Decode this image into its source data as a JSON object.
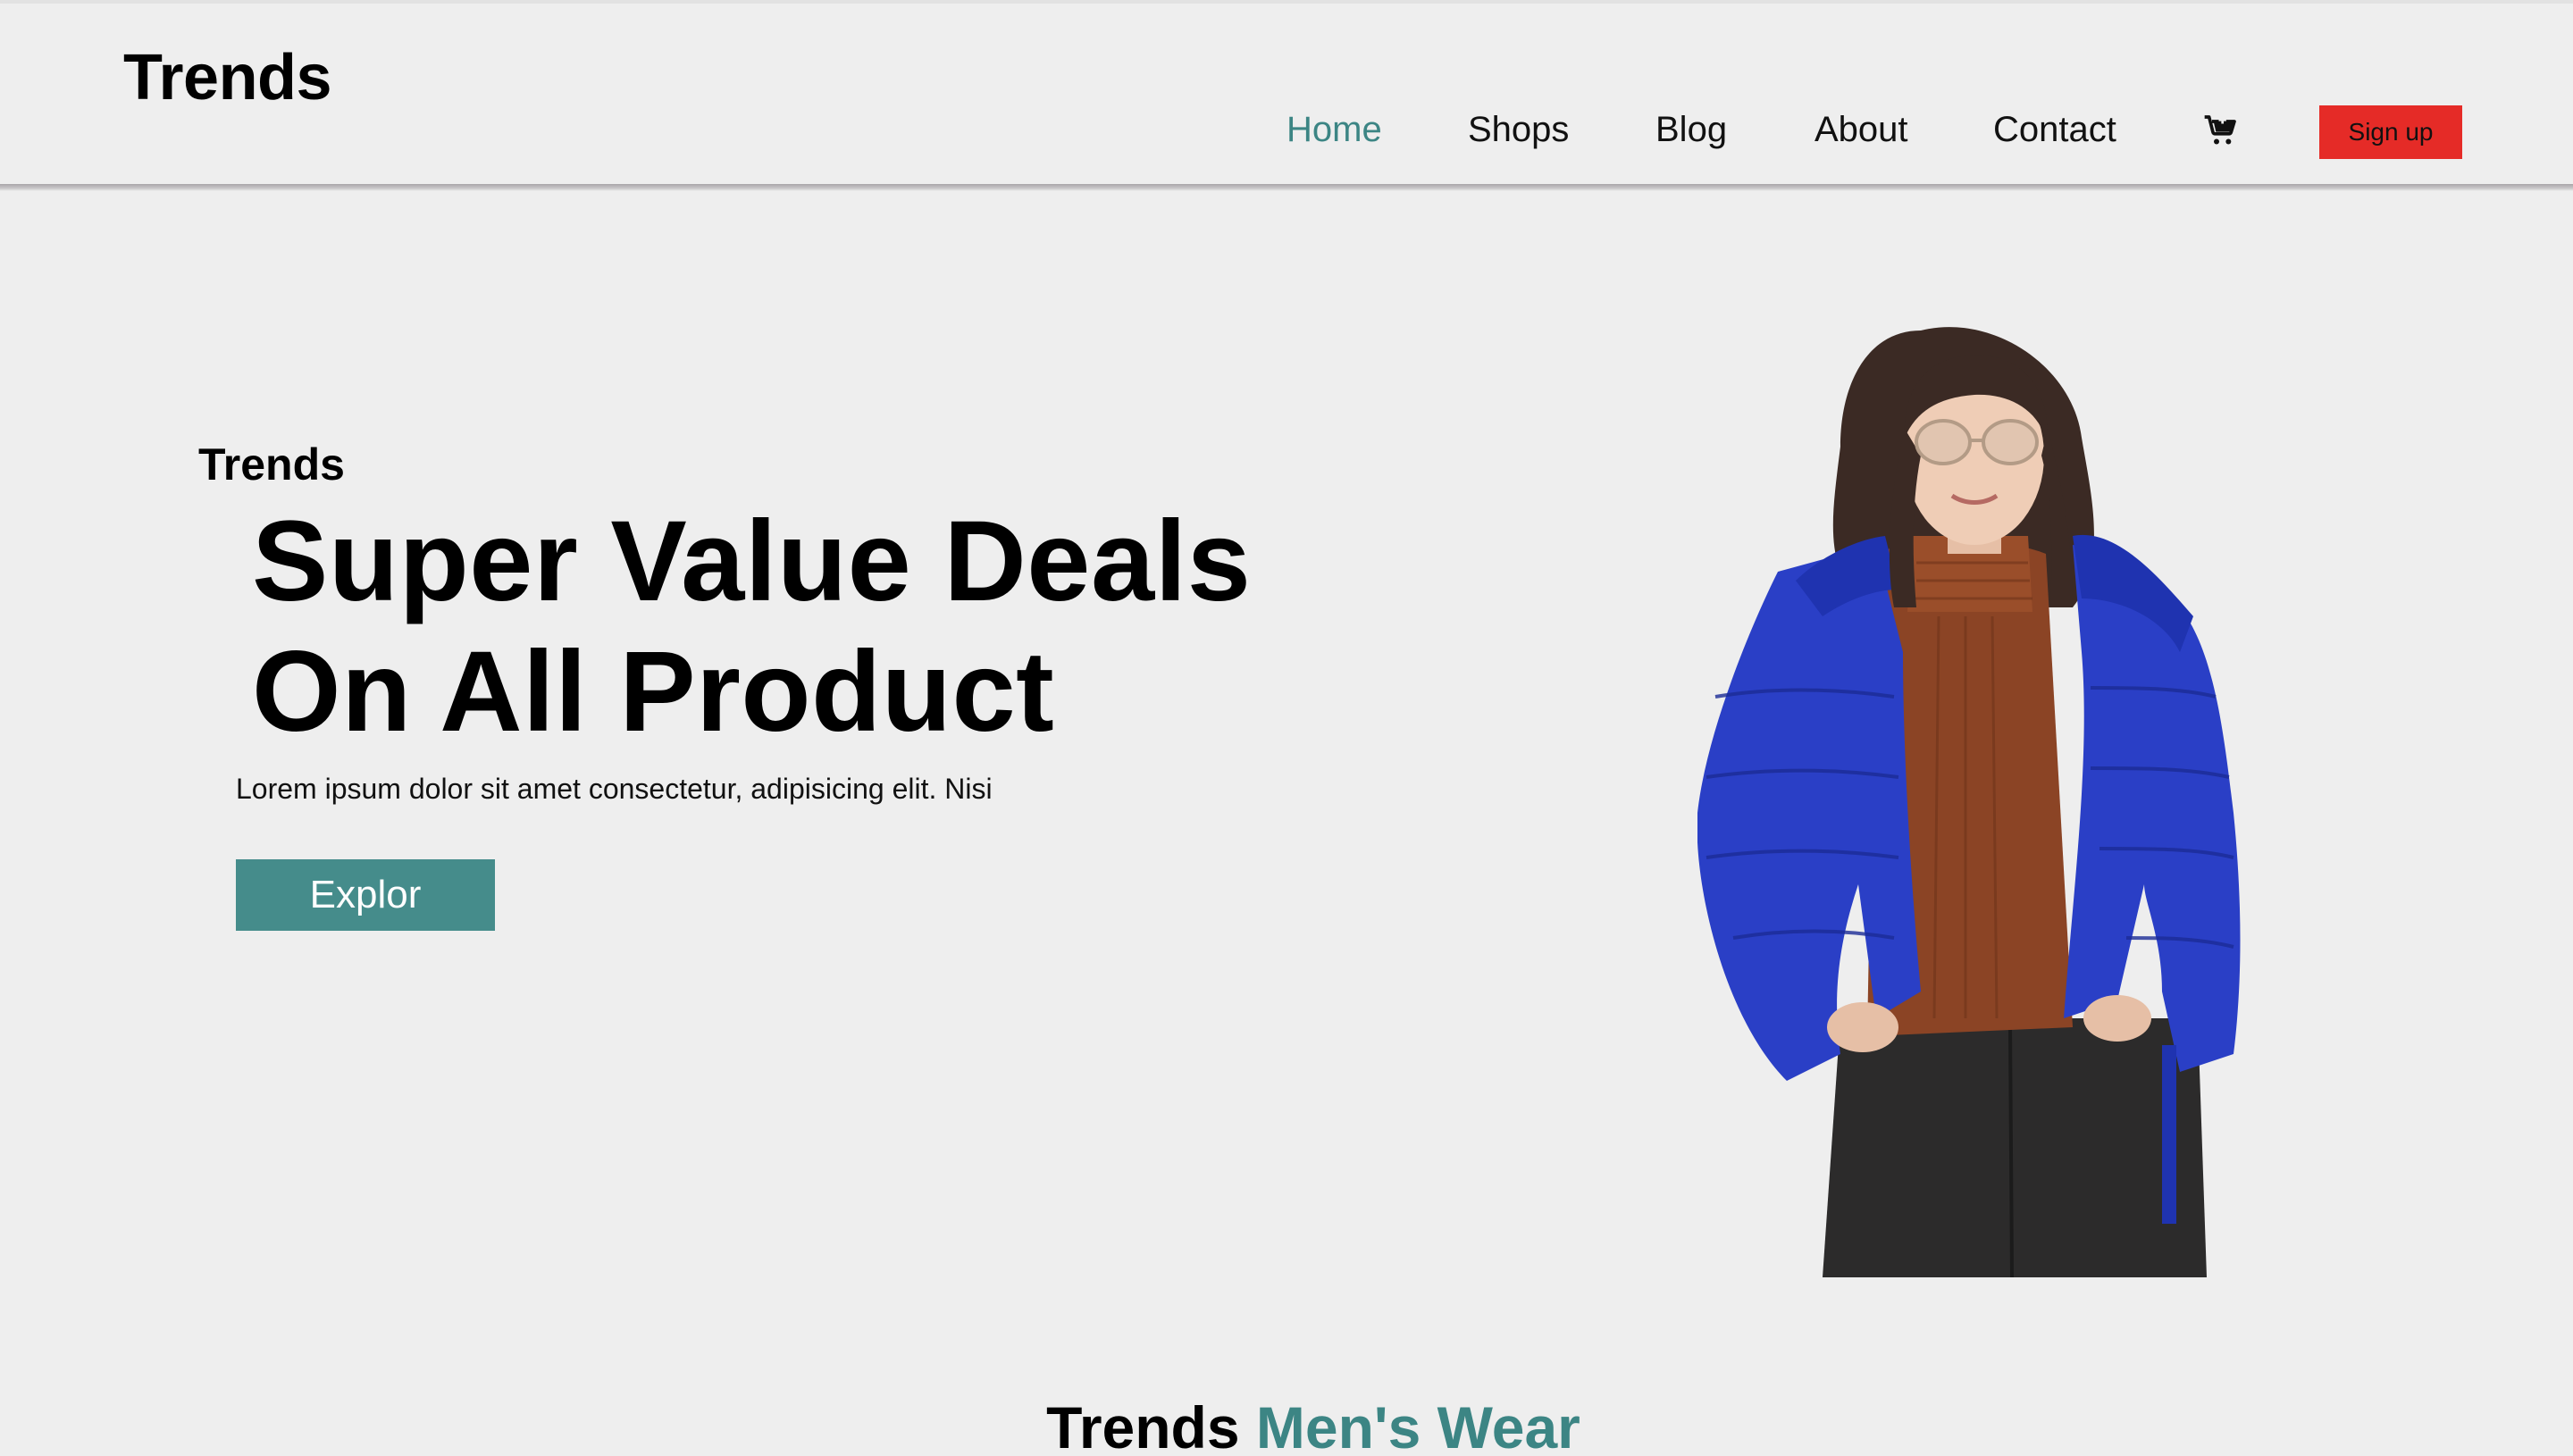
{
  "header": {
    "logo": "Trends",
    "nav": [
      {
        "label": "Home",
        "active": true
      },
      {
        "label": "Shops",
        "active": false
      },
      {
        "label": "Blog",
        "active": false
      },
      {
        "label": "About",
        "active": false
      },
      {
        "label": "Contact",
        "active": false
      }
    ],
    "cart_icon": "shopping-cart-icon",
    "signup_label": "Sign up"
  },
  "hero": {
    "kicker": "Trends",
    "title_line1": "Super Value Deals",
    "title_line2": "On All Product",
    "description": "Lorem ipsum dolor sit amet consectetur, adipisicing elit. Nisi",
    "button_label": "Explor"
  },
  "section": {
    "title_part1": "Trends",
    "title_part2": "Men's Wear"
  },
  "colors": {
    "accent": "#3c8584",
    "signup": "#e52b27",
    "button": "#458c8b",
    "background": "#eeeeee"
  }
}
